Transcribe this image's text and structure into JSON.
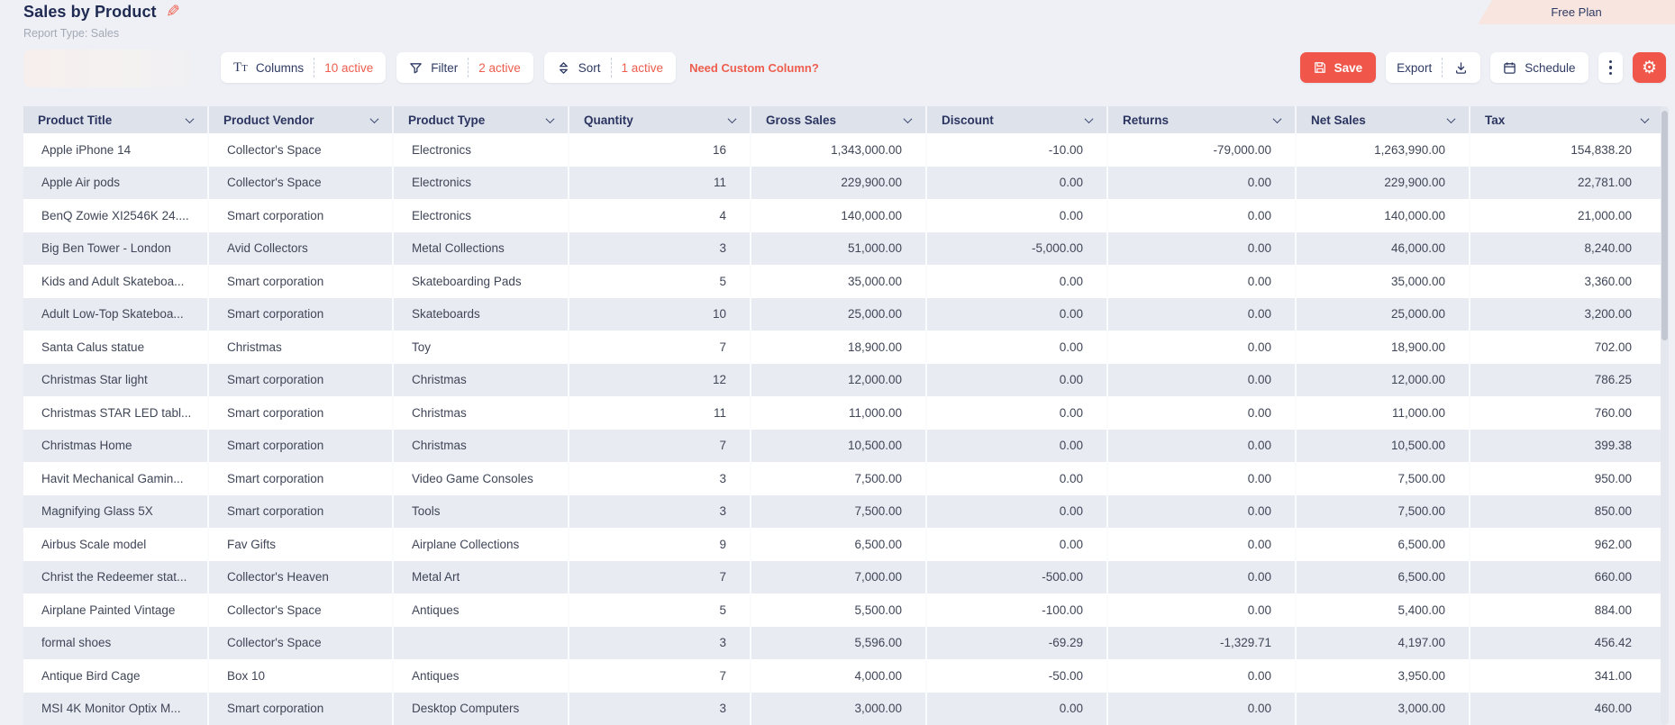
{
  "header": {
    "title": "Sales by Product",
    "subtitle": "Report Type: Sales",
    "plan_badge": "Free Plan"
  },
  "toolbar": {
    "columns_label": "Columns",
    "columns_active": "10 active",
    "filter_label": "Filter",
    "filter_active": "2 active",
    "sort_label": "Sort",
    "sort_active": "1 active",
    "custom_column_link": "Need Custom Column?",
    "save_label": "Save",
    "export_label": "Export",
    "schedule_label": "Schedule"
  },
  "icons": {
    "edit_icon": "✎",
    "columns_icon": "Tt",
    "filter_icon": "funnel",
    "sort_icon": "up-down-chevrons",
    "save_icon": "floppy-disk",
    "download_icon": "arrow-into-tray",
    "schedule_icon": "calendar",
    "kebab_icon": "⋮",
    "gear_icon": "⚙",
    "column_menu_icon": "⌄"
  },
  "colors": {
    "accent": "#f0564a",
    "title_text": "#1f2a52",
    "page_bg": "#eef0f5",
    "header_bg": "#dee2eb",
    "row_alt_bg": "#e9ebf2",
    "plan_badge_bg": "#f8e5df"
  },
  "table": {
    "columns": [
      "Product Title",
      "Product Vendor",
      "Product Type",
      "Quantity",
      "Gross Sales",
      "Discount",
      "Returns",
      "Net Sales",
      "Tax"
    ],
    "rows": [
      [
        "Apple iPhone 14",
        "Collector's Space",
        "Electronics",
        "16",
        "1,343,000.00",
        "-10.00",
        "-79,000.00",
        "1,263,990.00",
        "154,838.20"
      ],
      [
        "Apple Air pods",
        "Collector's Space",
        "Electronics",
        "11",
        "229,900.00",
        "0.00",
        "0.00",
        "229,900.00",
        "22,781.00"
      ],
      [
        "BenQ Zowie XI2546K 24....",
        "Smart corporation",
        "Electronics",
        "4",
        "140,000.00",
        "0.00",
        "0.00",
        "140,000.00",
        "21,000.00"
      ],
      [
        "Big Ben Tower - London",
        "Avid Collectors",
        "Metal Collections",
        "3",
        "51,000.00",
        "-5,000.00",
        "0.00",
        "46,000.00",
        "8,240.00"
      ],
      [
        "Kids and Adult Skateboa...",
        "Smart corporation",
        "Skateboarding Pads",
        "5",
        "35,000.00",
        "0.00",
        "0.00",
        "35,000.00",
        "3,360.00"
      ],
      [
        "Adult Low-Top Skateboa...",
        "Smart corporation",
        "Skateboards",
        "10",
        "25,000.00",
        "0.00",
        "0.00",
        "25,000.00",
        "3,200.00"
      ],
      [
        "Santa Calus statue",
        "Christmas",
        "Toy",
        "7",
        "18,900.00",
        "0.00",
        "0.00",
        "18,900.00",
        "702.00"
      ],
      [
        "Christmas Star light",
        "Smart corporation",
        "Christmas",
        "12",
        "12,000.00",
        "0.00",
        "0.00",
        "12,000.00",
        "786.25"
      ],
      [
        "Christmas STAR LED tabl...",
        "Smart corporation",
        "Christmas",
        "11",
        "11,000.00",
        "0.00",
        "0.00",
        "11,000.00",
        "760.00"
      ],
      [
        "Christmas Home",
        "Smart corporation",
        "Christmas",
        "7",
        "10,500.00",
        "0.00",
        "0.00",
        "10,500.00",
        "399.38"
      ],
      [
        "Havit Mechanical Gamin...",
        "Smart corporation",
        "Video Game Consoles",
        "3",
        "7,500.00",
        "0.00",
        "0.00",
        "7,500.00",
        "950.00"
      ],
      [
        "Magnifying Glass 5X",
        "Smart corporation",
        "Tools",
        "3",
        "7,500.00",
        "0.00",
        "0.00",
        "7,500.00",
        "850.00"
      ],
      [
        "Airbus Scale model",
        "Fav Gifts",
        "Airplane Collections",
        "9",
        "6,500.00",
        "0.00",
        "0.00",
        "6,500.00",
        "962.00"
      ],
      [
        "Christ the Redeemer stat...",
        "Collector's Heaven",
        "Metal Art",
        "7",
        "7,000.00",
        "-500.00",
        "0.00",
        "6,500.00",
        "660.00"
      ],
      [
        "Airplane Painted Vintage",
        "Collector's Space",
        "Antiques",
        "5",
        "5,500.00",
        "-100.00",
        "0.00",
        "5,400.00",
        "884.00"
      ],
      [
        "formal shoes",
        "Collector's Space",
        "",
        "3",
        "5,596.00",
        "-69.29",
        "-1,329.71",
        "4,197.00",
        "456.42"
      ],
      [
        "Antique Bird Cage",
        "Box 10",
        "Antiques",
        "7",
        "4,000.00",
        "-50.00",
        "0.00",
        "3,950.00",
        "341.00"
      ],
      [
        "MSI 4K Monitor Optix M...",
        "Smart corporation",
        "Desktop Computers",
        "3",
        "3,000.00",
        "0.00",
        "0.00",
        "3,000.00",
        "460.00"
      ]
    ]
  }
}
